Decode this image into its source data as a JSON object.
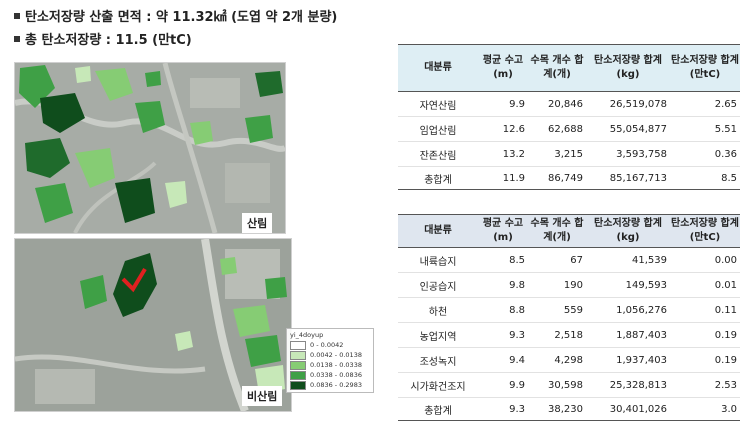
{
  "headline": {
    "line1": "탄소저장량 산출 면적 : 약 11.32㎢ (도엽 약 2개 분량)",
    "line2": "총 탄소저장량 : 11.5 (만tC)"
  },
  "maps": {
    "forest_label": "산림",
    "nonforest_label": "비산림",
    "legend": {
      "title": "yi_4doyup",
      "items": [
        {
          "label": "0 - 0.0042",
          "color": "#ffffff"
        },
        {
          "label": "0.0042 - 0.0138",
          "color": "#c7e8b8"
        },
        {
          "label": "0.0138 - 0.0338",
          "color": "#86cc74"
        },
        {
          "label": "0.0338 - 0.0836",
          "color": "#3fa046"
        },
        {
          "label": "0.0836 - 0.2983",
          "color": "#0f4d1c"
        }
      ]
    }
  },
  "forest_table": {
    "headers": [
      "대분류",
      "평균 수고(m)",
      "수목 개수 합계(개)",
      "탄소저장량 합계(kg)",
      "탄소저장량 합계(만tC)"
    ],
    "rows": [
      [
        "자연산림",
        "9.9",
        "20,846",
        "26,519,078",
        "2.65"
      ],
      [
        "임업산림",
        "12.6",
        "62,688",
        "55,054,877",
        "5.51"
      ],
      [
        "잔존산림",
        "13.2",
        "3,215",
        "3,593,758",
        "0.36"
      ]
    ],
    "total": [
      "총합계",
      "11.9",
      "86,749",
      "85,167,713",
      "8.5"
    ]
  },
  "nonforest_table": {
    "headers": [
      "대분류",
      "평균 수고(m)",
      "수목 개수 합계(개)",
      "탄소저장량 합계(kg)",
      "탄소저장량 합계(만tC)"
    ],
    "rows": [
      [
        "내륙습지",
        "8.5",
        "67",
        "41,539",
        "0.00"
      ],
      [
        "인공습지",
        "9.8",
        "190",
        "149,593",
        "0.01"
      ],
      [
        "하천",
        "8.8",
        "559",
        "1,056,276",
        "0.11"
      ],
      [
        "농업지역",
        "9.3",
        "2,518",
        "1,887,403",
        "0.19"
      ],
      [
        "조성녹지",
        "9.4",
        "4,298",
        "1,937,403",
        "0.19"
      ],
      [
        "시가화건조지",
        "9.9",
        "30,598",
        "25,328,813",
        "2.53"
      ]
    ],
    "total": [
      "총합계",
      "9.3",
      "38,230",
      "30,401,026",
      "3.0"
    ]
  }
}
